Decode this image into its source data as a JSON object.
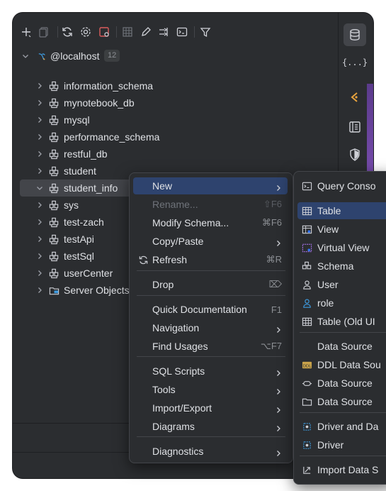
{
  "toolbar": {
    "icons": [
      "add-icon",
      "duplicate-icon",
      "refresh-icon",
      "settings-icon",
      "stop-icon",
      "table-icon",
      "edit-icon",
      "jump-icon",
      "console-icon",
      "filter-icon"
    ]
  },
  "tree": {
    "root": {
      "label": "@localhost",
      "badge": "12"
    },
    "items": [
      {
        "label": "information_schema"
      },
      {
        "label": "mynotebook_db"
      },
      {
        "label": "mysql"
      },
      {
        "label": "performance_schema"
      },
      {
        "label": "restful_db"
      },
      {
        "label": "student"
      },
      {
        "label": "student_info"
      },
      {
        "label": "sys"
      },
      {
        "label": "test-zach"
      },
      {
        "label": "testApi"
      },
      {
        "label": "testSql"
      },
      {
        "label": "userCenter"
      },
      {
        "label": "Server Objects"
      }
    ]
  },
  "sidebar": {
    "items": [
      "database-icon",
      "json-icon",
      "ai-assistant-icon",
      "notebook-icon",
      "shield-icon"
    ],
    "json_label": "{...}"
  },
  "context_menu": {
    "items": [
      {
        "label": "New",
        "shortcut": "",
        "submenu": true,
        "disabled": false
      },
      {
        "label": "Rename...",
        "shortcut": "⇧F6",
        "submenu": false,
        "disabled": true
      },
      {
        "label": "Modify Schema...",
        "shortcut": "⌘F6",
        "submenu": false,
        "disabled": false
      },
      {
        "label": "Copy/Paste",
        "shortcut": "",
        "submenu": true,
        "disabled": false
      },
      {
        "label": "Refresh",
        "shortcut": "⌘R",
        "submenu": false,
        "disabled": false
      },
      {
        "label": "Drop",
        "shortcut": "⌦",
        "submenu": false,
        "disabled": false
      },
      {
        "label": "Quick Documentation",
        "shortcut": "F1",
        "submenu": false,
        "disabled": false
      },
      {
        "label": "Navigation",
        "shortcut": "",
        "submenu": true,
        "disabled": false
      },
      {
        "label": "Find Usages",
        "shortcut": "⌥F7",
        "submenu": false,
        "disabled": false
      },
      {
        "label": "SQL Scripts",
        "shortcut": "",
        "submenu": true,
        "disabled": false
      },
      {
        "label": "Tools",
        "shortcut": "",
        "submenu": true,
        "disabled": false
      },
      {
        "label": "Import/Export",
        "shortcut": "",
        "submenu": true,
        "disabled": false
      },
      {
        "label": "Diagrams",
        "shortcut": "",
        "submenu": true,
        "disabled": false
      },
      {
        "label": "Diagnostics",
        "shortcut": "",
        "submenu": true,
        "disabled": false
      }
    ]
  },
  "submenu": {
    "items": [
      {
        "label": "Query Conso",
        "icon": "console-icon"
      },
      {
        "label": "Table",
        "icon": "table-icon"
      },
      {
        "label": "View",
        "icon": "view-icon"
      },
      {
        "label": "Virtual View",
        "icon": "virtual-view-icon"
      },
      {
        "label": "Schema",
        "icon": "schema-icon"
      },
      {
        "label": "User",
        "icon": "user-icon"
      },
      {
        "label": "role",
        "icon": "role-icon"
      },
      {
        "label": "Table (Old UI",
        "icon": "table-old-icon"
      },
      {
        "label": "Data Source",
        "icon": ""
      },
      {
        "label": "DDL Data Sou",
        "icon": "ddl-icon"
      },
      {
        "label": "Data Source",
        "icon": "data-source-url-icon"
      },
      {
        "label": "Data Source",
        "icon": "folder-icon"
      },
      {
        "label": "Driver and Da",
        "icon": "driver-data-source-icon"
      },
      {
        "label": "Driver",
        "icon": "driver-icon"
      },
      {
        "label": "Import Data S",
        "icon": "import-icon"
      }
    ]
  },
  "colors": {
    "background": "#2b2d30",
    "selection": "#43454a",
    "menu_highlight": "#2e436e",
    "text": "#dfe1e5",
    "accent_blue": "#3574f0"
  }
}
